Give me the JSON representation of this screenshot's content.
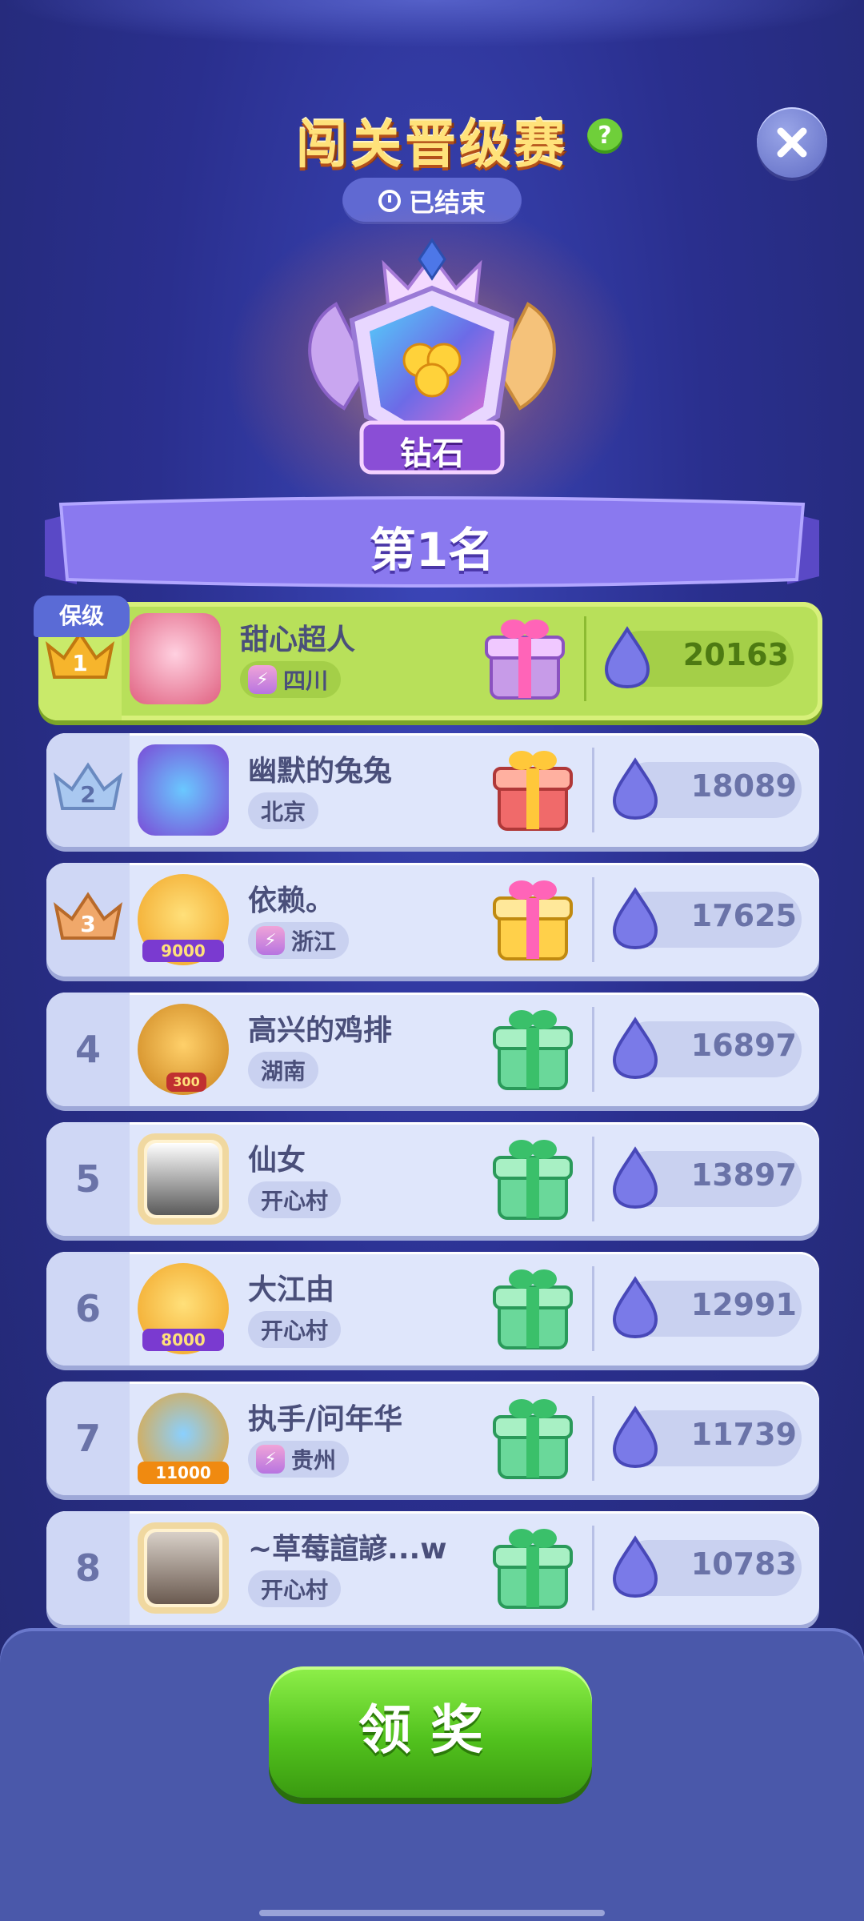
{
  "header": {
    "title": "闯关晋级赛",
    "help_label": "?",
    "status": "已结束"
  },
  "badge": {
    "tier": "钻石"
  },
  "rank_banner": {
    "text": "第1名"
  },
  "keep_tag": "保级",
  "players": [
    {
      "rank": "1",
      "name": "甜心超人",
      "location": "四川",
      "score": "20163",
      "vip": true
    },
    {
      "rank": "2",
      "name": "幽默的兔兔",
      "location": "北京",
      "score": "18089",
      "vip": false
    },
    {
      "rank": "3",
      "name": "依赖。",
      "location": "浙江",
      "score": "17625",
      "vip": true,
      "frame_label": "9000"
    },
    {
      "rank": "4",
      "name": "高兴的鸡排",
      "location": "湖南",
      "score": "16897",
      "vip": false,
      "frame_label": "300"
    },
    {
      "rank": "5",
      "name": "仙女",
      "location": "开心村",
      "score": "13897",
      "vip": false
    },
    {
      "rank": "6",
      "name": "大江由",
      "location": "开心村",
      "score": "12991",
      "vip": false,
      "frame_label": "8000"
    },
    {
      "rank": "7",
      "name": "执手/问年华",
      "location": "贵州",
      "score": "11739",
      "vip": true,
      "frame_label": "11000"
    },
    {
      "rank": "8",
      "name": "~草莓諠諺...w",
      "location": "开心村",
      "score": "10783",
      "vip": false
    }
  ],
  "claim_button": "领奖",
  "colors": {
    "accent_green": "#52c21e",
    "highlight_row": "#b8e05a",
    "panel": "#4a58aa"
  }
}
